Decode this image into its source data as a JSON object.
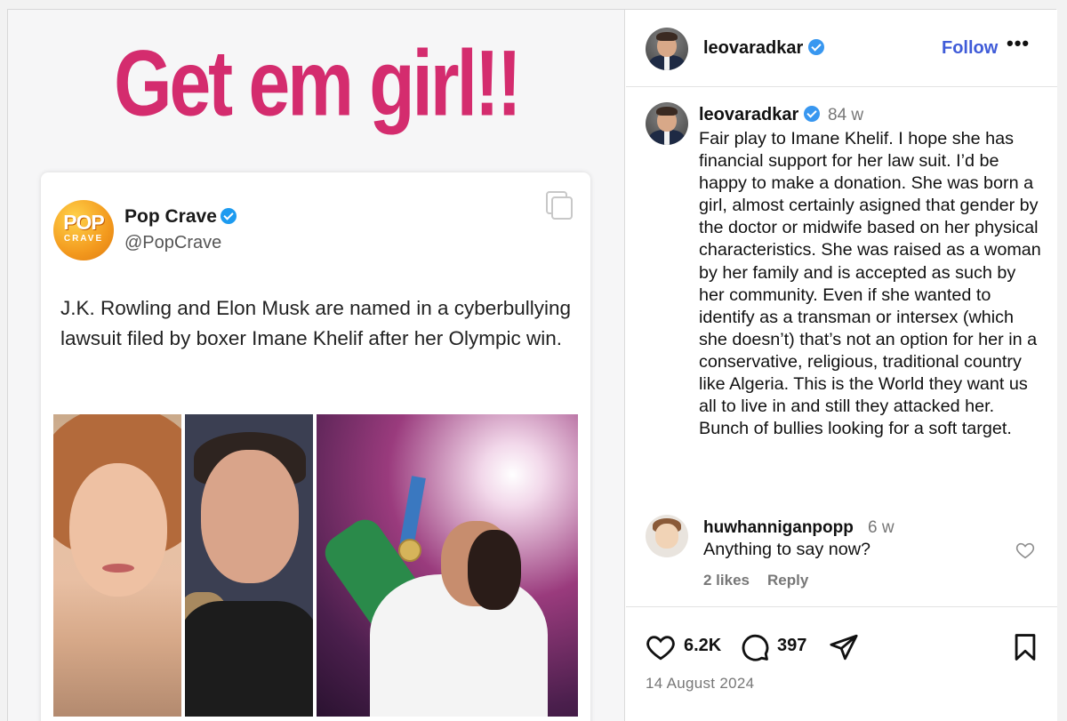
{
  "media": {
    "headline": "Get em girl!!",
    "tweet": {
      "avatar_top": "POP",
      "avatar_bottom": "CRAVE",
      "name": "Pop Crave",
      "handle": "@PopCrave",
      "text": "J.K. Rowling and Elon Musk are named in a cyberbullying lawsuit filed by boxer Imane Khelif after her Olympic win."
    }
  },
  "sidebar": {
    "header": {
      "username": "leovaradkar",
      "follow_label": "Follow",
      "more_label": "•••"
    },
    "caption": {
      "username": "leovaradkar",
      "time": "84 w",
      "text": "Fair play to Imane Khelif. I hope she has financial support for her law suit. I’d be happy to make a donation.  She was born a girl, almost certainly asigned that gender by the doctor or midwife based on her physical characteristics. She was raised as a woman by her family and is accepted as such by her community. Even if she wanted to identify as a transman or intersex (which she doesn’t) that’s not an option for her in a conservative, religious, traditional country like Algeria. This is the World they want us all to live in and still they attacked her. Bunch of bullies looking for a soft target."
    },
    "comment": {
      "username": "huwhanniganpopp",
      "time": "6 w",
      "text": "Anything to say now?",
      "likes": "2 likes",
      "reply_label": "Reply"
    },
    "actions": {
      "likes_count": "6.2K",
      "comments_count": "397",
      "date": "14 August 2024"
    }
  },
  "colors": {
    "headline": "#d42c6e",
    "follow": "#3f5bd8",
    "verified": "#3897f0",
    "muted": "#777777"
  }
}
